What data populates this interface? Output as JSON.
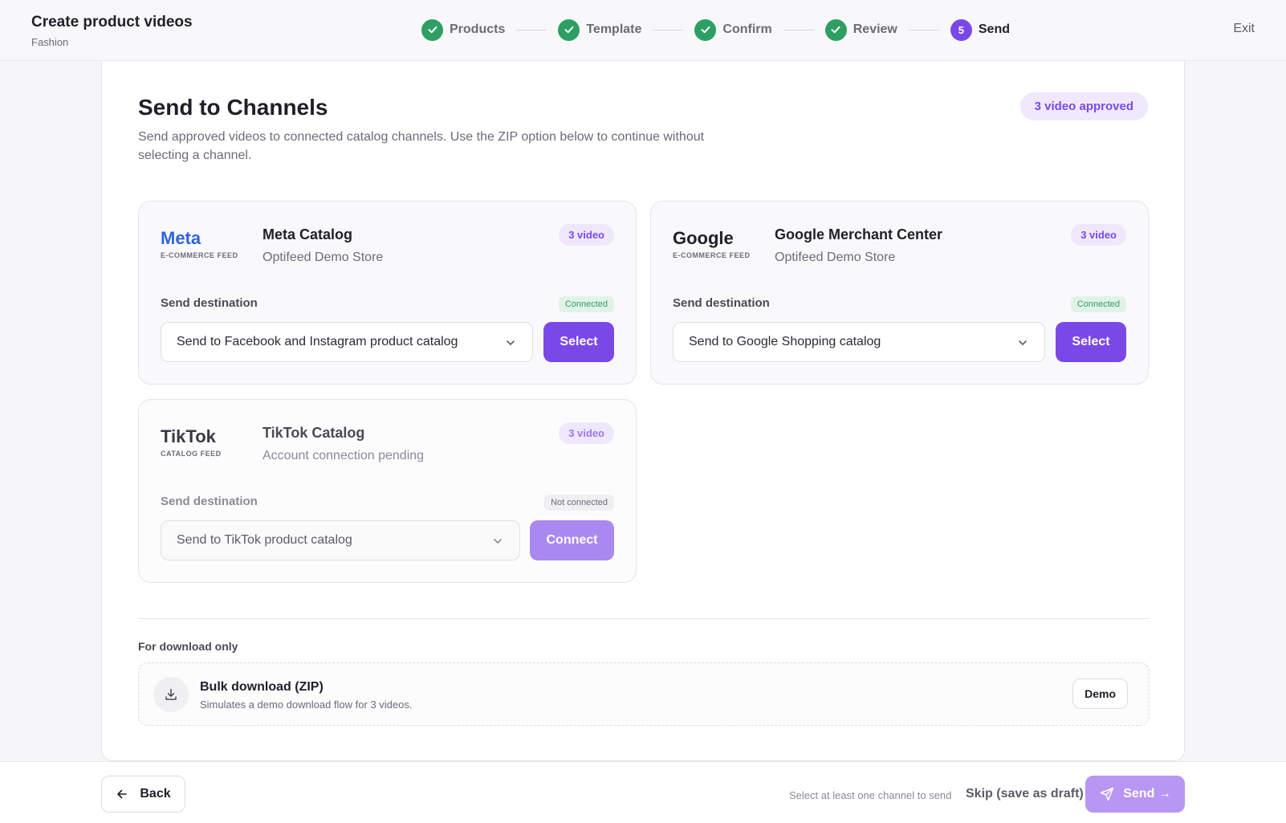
{
  "header": {
    "title": "Create product videos",
    "subtitle": "Fashion",
    "exit_label": "Exit",
    "steps": [
      {
        "label": "Products",
        "state": "done"
      },
      {
        "label": "Template",
        "state": "done"
      },
      {
        "label": "Confirm",
        "state": "done"
      },
      {
        "label": "Review",
        "state": "done"
      },
      {
        "label": "Send",
        "number": "5",
        "state": "active"
      }
    ]
  },
  "main": {
    "title": "Send to Channels",
    "description": "Send approved videos to connected catalog channels. Use the ZIP option below to continue without selecting a channel.",
    "approved_badge": "3 video approved",
    "channels": [
      {
        "logo": "Meta",
        "logo_sub": "E-COMMERCE FEED",
        "logo_color": "#2f64d8",
        "name": "Meta Catalog",
        "account": "Optifeed Demo Store",
        "video_count": "3 video",
        "dest_label": "Send destination",
        "status": "Connected",
        "destination": "Send to Facebook and Instagram product catalog",
        "action": "Select"
      },
      {
        "logo": "Google",
        "logo_sub": "E-COMMERCE FEED",
        "logo_color": "#1f1f29",
        "name": "Google Merchant Center",
        "account": "Optifeed Demo Store",
        "video_count": "3 video",
        "dest_label": "Send destination",
        "status": "Connected",
        "destination": "Send to Google Shopping catalog",
        "action": "Select"
      },
      {
        "logo": "TikTok",
        "logo_sub": "CATALOG FEED",
        "logo_color": "#3a3a44",
        "name": "TikTok Catalog",
        "account": "Account connection pending",
        "video_count": "3 video",
        "dest_label": "Send destination",
        "status": "Not connected",
        "destination": "Send to TikTok product catalog",
        "action": "Connect"
      }
    ],
    "download": {
      "section_label": "For download only",
      "title": "Bulk download (ZIP)",
      "subtitle": "Simulates a demo download flow for 3 videos.",
      "button": "Demo"
    }
  },
  "footer": {
    "back_label": "Back",
    "hint": "Select at least one channel to send",
    "skip_label": "Skip (save as draft)",
    "send_label": "Send →"
  },
  "colors": {
    "accent": "#7b48e8",
    "success": "#2e9f63"
  }
}
